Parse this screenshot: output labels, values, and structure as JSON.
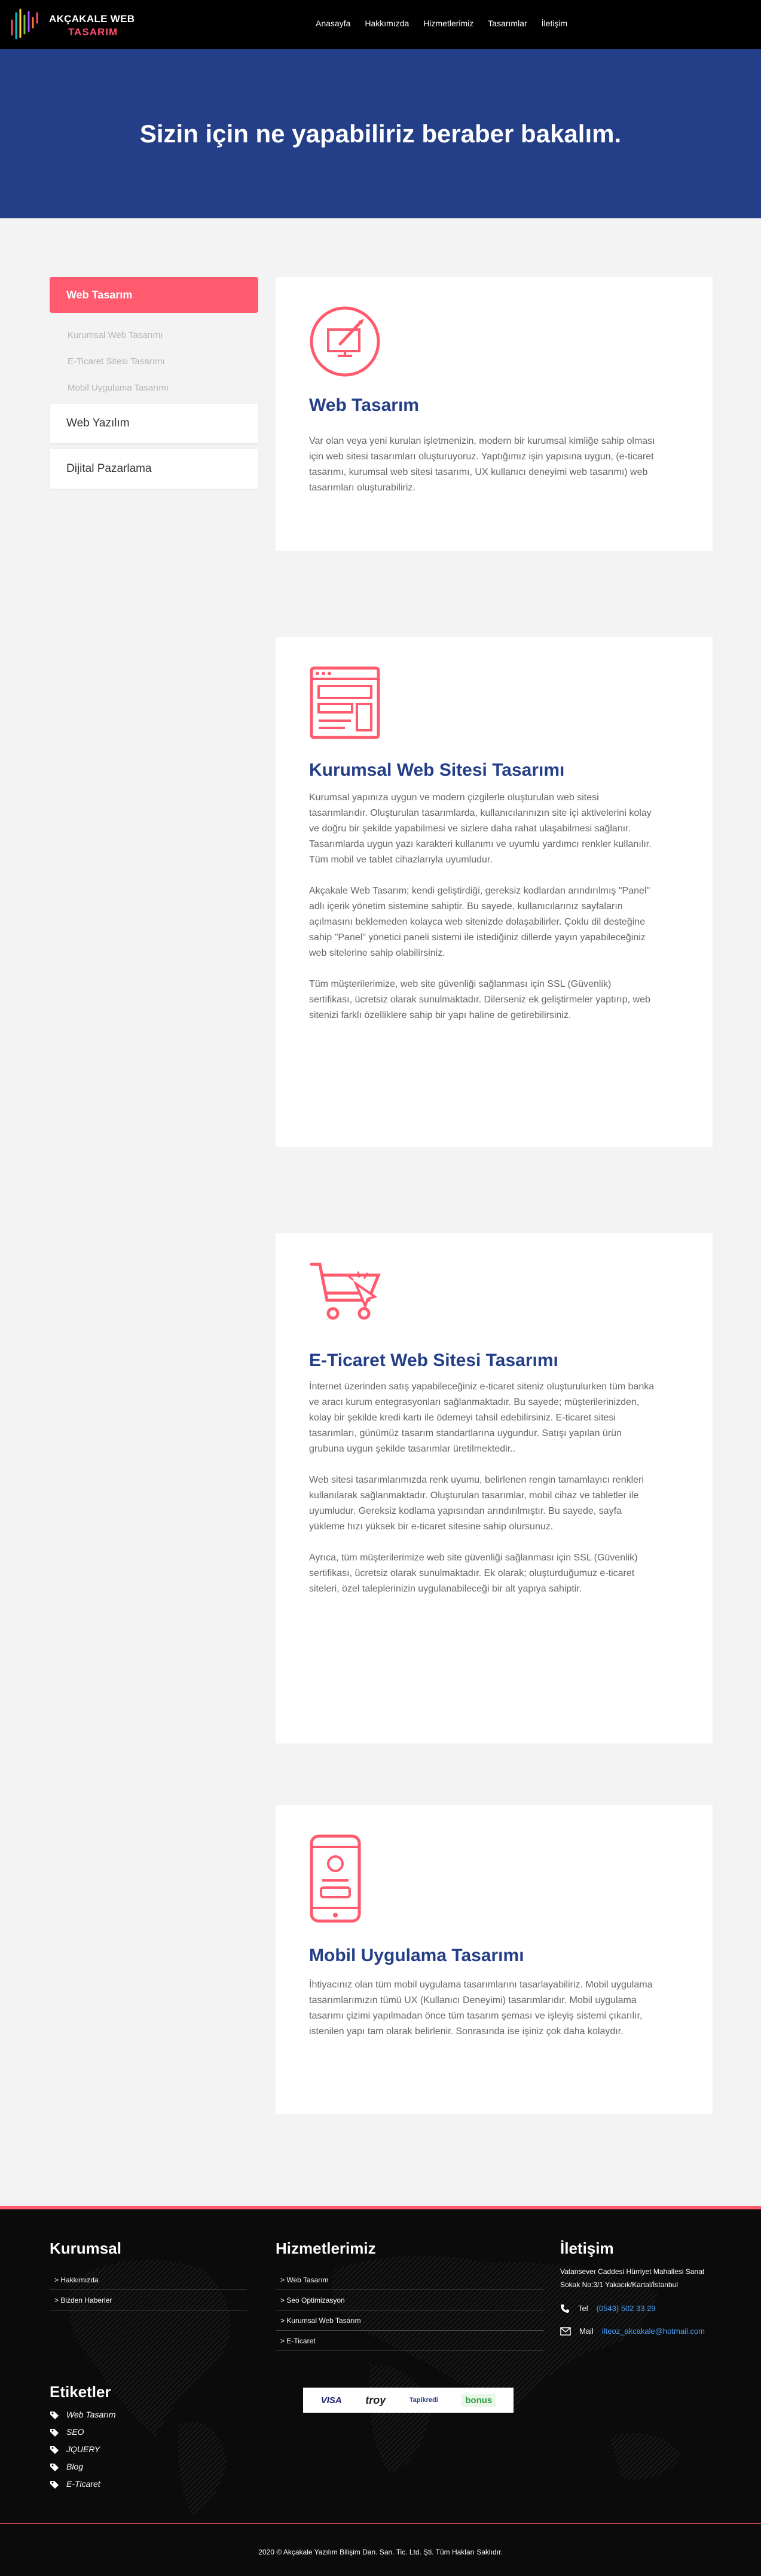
{
  "header": {
    "logo_line1": "AKÇAKALE WEB",
    "logo_line2": "TASARIM",
    "nav": [
      "Anasayfa",
      "Hakkımızda",
      "Hizmetlerimiz",
      "Tasarımlar",
      "İletişim"
    ]
  },
  "hero": {
    "title": "Sizin için ne yapabiliriz beraber bakalım."
  },
  "sidebar": {
    "active": "Web Tasarım",
    "sub_items": [
      "Kurumsal Web Tasarımı",
      "E-Ticaret Sitesi Tasarımı",
      "Mobil Uygulama Tasarımı"
    ],
    "items": [
      "Web Yazılım",
      "Dijital Pazarlama"
    ]
  },
  "sections": [
    {
      "icon": "design-monitor-icon",
      "title": "Web Tasarım",
      "paragraphs": [
        "Var olan veya yeni kurulan işletmenizin, modern bir kurumsal kimliğe sahip olması için web sitesi tasarımları oluşturuyoruz. Yaptığımız işin yapısına uygun, (e-ticaret tasarımı, kurumsal web sitesi tasarımı, UX kullanıcı deneyimi web tasarımı) web tasarımları oluşturabiliriz."
      ]
    },
    {
      "icon": "website-layout-icon",
      "title": "Kurumsal Web Sitesi Tasarımı",
      "paragraphs": [
        "Kurumsal yapınıza uygun ve modern çizgilerle oluşturulan web sitesi tasarımlarıdır. Oluşturulan tasarımlarda, kullanıcılarınızın site içi aktivelerini kolay ve doğru bir şekilde yapabilmesi ve sizlere daha rahat ulaşabilmesi sağlanır. Tasarımlarda uygun yazı karakteri kullanımı ve uyumlu yardımcı renkler kullanılır. Tüm mobil ve tablet cihazlarıyla uyumludur.",
        "Akçakale Web Tasarım; kendi geliştirdiği, gereksiz kodlardan arındırılmış \"Panel\" adlı içerik yönetim sistemine sahiptir. Bu sayede, kullanıcılarınız sayfaların açılmasını beklemeden kolayca web sitenizde dolaşabilirler. Çoklu dil desteğine sahip \"Panel\" yönetici paneli sistemi ile istediğiniz dillerde yayın yapabileceğiniz web sitelerine sahip olabilirsiniz.",
        "Tüm müşterilerimize, web site güvenliği sağlanması için SSL (Güvenlik) sertifikası, ücretsiz olarak sunulmaktadır. Dilerseniz ek geliştirmeler yaptırıp, web sitenizi farklı özelliklere sahip bir yapı haline de getirebilirsiniz."
      ]
    },
    {
      "icon": "shopping-cart-icon",
      "title": "E-Ticaret Web Sitesi Tasarımı",
      "paragraphs": [
        "İnternet üzerinden satış yapabileceğiniz e-ticaret siteniz oluşturulurken tüm banka ve aracı kurum entegrasyonları sağlanmaktadır. Bu sayede; müşterilerinizden, kolay bir şekilde kredi kartı ile ödemeyi tahsil edebilirsiniz. E-ticaret sitesi tasarımları, günümüz tasarım standartlarına uygundur. Satışı yapılan ürün grubuna uygun şekilde tasarımlar üretilmektedir..",
        "Web sitesi tasarımlarımızda renk uyumu, belirlenen rengin tamamlayıcı renkleri kullanılarak sağlanmaktadır. Oluşturulan tasarımlar, mobil cihaz ve tabletler ile uyumludur. Gereksiz kodlama yapısından arındırılmıştır. Bu sayede, sayfa yükleme hızı yüksek bir e-ticaret sitesine sahip olursunuz.",
        "Ayrıca, tüm müşterilerimize web site güvenliği sağlanması için SSL (Güvenlik) sertifikası, ücretsiz olarak sunulmaktadır. Ek olarak; oluşturduğumuz e-ticaret siteleri, özel taleplerinizin uygulanabileceği bir alt yapıya sahiptir."
      ]
    },
    {
      "icon": "mobile-phone-icon",
      "title": "Mobil Uygulama Tasarımı",
      "paragraphs": [
        "İhtiyacınız olan tüm mobil uygulama tasarımlarını tasarlayabiliriz. Mobil uygulama tasarımlarımızın tümü UX (Kullanıcı Deneyimi) tasarımlarıdır. Mobil uygulama tasarımı çizimi yapılmadan önce tüm tasarım şeması ve işleyiş sistemi çıkarılır, istenilen yapı tam olarak belirlenir. Sonrasında ise işiniz çok daha kolaydır."
      ]
    }
  ],
  "footer": {
    "kurumsal_title": "Kurumsal",
    "kurumsal_items": [
      "> Hakkımızda",
      "> Bizden Haberler"
    ],
    "hizmet_title": "Hizmetlerimiz",
    "hizmet_items": [
      "> Web Tasarım",
      "> Seo Optimizasyon",
      "> Kurumsal Web Tasarım",
      "> E-Ticaret"
    ],
    "iletisim_title": "İletişim",
    "address": "Vatansever Caddesi Hürriyet Mahallesi Sanat Sokak No:3/1 Yakacık/Kartal/İstanbul",
    "tel_label": "Tel",
    "tel_value": "(0543) 502 33 29",
    "mail_label": "Mail",
    "mail_value": "ilteoz_akcakale@hotmail.com",
    "tags_title": "Etiketler",
    "tags": [
      "Web Tasarım",
      "SEO",
      "JQUERY",
      "Blog",
      "E-Ticaret"
    ],
    "payment_logos": [
      "VISA",
      "troy",
      "Tapikredi",
      "bonus"
    ],
    "copyright": "2020 © Akçakale Yazılım Bilişim Dan. San. Tic. Ltd. Şti. Tüm Hakları Saklıdır."
  },
  "colors": {
    "accent": "#ff5a6e",
    "navy": "#243f87",
    "dark": "#0b0b0b"
  }
}
